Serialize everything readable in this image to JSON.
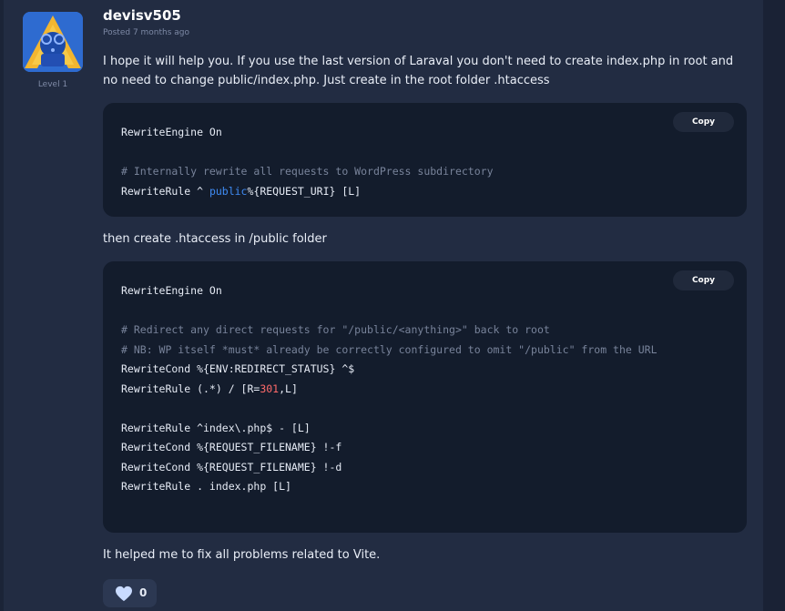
{
  "reply": {
    "author": "devisv505",
    "level": "Level 1",
    "posted": "Posted 7 months ago",
    "intro": "I hope it will help you. If you use the last version of Laraval you don't need to create index.php in root and no need to change public/index.php. Just create in the root folder .htaccess",
    "middle": "then create .htaccess in /public folder",
    "outro": "It helped me to fix all problems related to Vite.",
    "like_count": "0"
  },
  "code_blocks": [
    {
      "copy_label": "Copy",
      "lines": [
        "RewriteEngine On",
        "",
        "# Internally rewrite all requests to WordPress subdirectory",
        [
          "RewriteRule ^ ",
          "public",
          "%{REQUEST_URI} [L]"
        ]
      ]
    },
    {
      "copy_label": "Copy",
      "lines": [
        "RewriteEngine On",
        "",
        "# Redirect any direct requests for \"/public/<anything>\" back to root",
        "# NB: WP itself *must* already be correctly configured to omit \"/public\" from the URL",
        "RewriteCond %{ENV:REDIRECT_STATUS} ^$",
        [
          "RewriteRule (.*) / [R=",
          "301",
          ",L]"
        ],
        "",
        "RewriteRule ^index\\.php$ - [L]",
        "RewriteCond %{REQUEST_FILENAME} !-f",
        "RewriteCond %{REQUEST_FILENAME} !-d",
        "RewriteRule . index.php [L]"
      ]
    }
  ],
  "colors": {
    "keyword": "#3f8cf5",
    "number": "#ff6a6a",
    "comment": "#78839a",
    "code_bg": "#131c2c"
  },
  "icons": {
    "avatar": "avatar-illustration",
    "like": "heart-icon"
  }
}
